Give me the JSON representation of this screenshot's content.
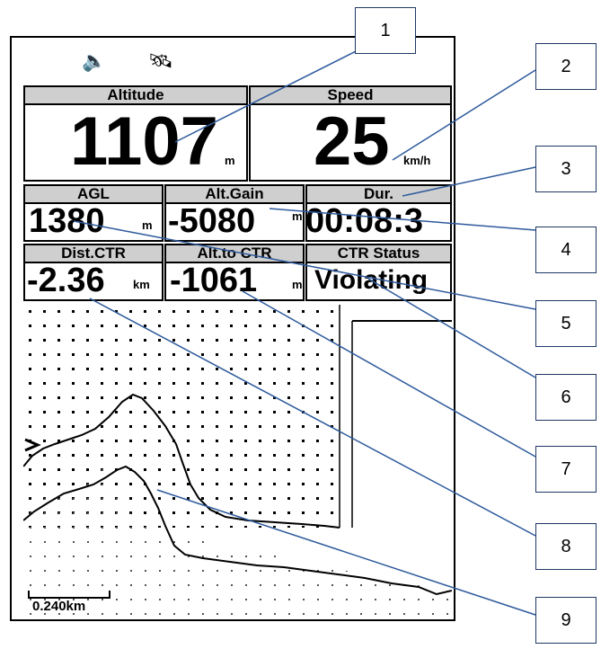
{
  "status_icons": {
    "speaker": "speaker-icon",
    "gps": "gps-satellite-icon"
  },
  "colors": {
    "label_bg": "#cfcfcf",
    "callout_border": "#1f3864",
    "leader_line": "#2e5a9c"
  },
  "panels": {
    "altitude": {
      "label": "Altitude",
      "value": "1107",
      "unit": "m"
    },
    "speed": {
      "label": "Speed",
      "value": "25",
      "unit": "km/h"
    },
    "agl": {
      "label": "AGL",
      "value": "1380",
      "unit": "m"
    },
    "alt_gain": {
      "label": "Alt.Gain",
      "value": "-5080",
      "unit": "m"
    },
    "duration": {
      "label": "Dur.",
      "value": "00:08:3"
    },
    "dist_ctr": {
      "label": "Dist.CTR",
      "value": "-2.36",
      "unit": "km"
    },
    "alt_to_ctr": {
      "label": "Alt.to CTR",
      "value": "-1061",
      "unit": "m"
    },
    "ctr_status": {
      "label": "CTR Status",
      "value": "Violating"
    }
  },
  "map": {
    "scale_label": "0.240km"
  },
  "callouts": [
    "1",
    "2",
    "3",
    "4",
    "5",
    "6",
    "7",
    "8",
    "9"
  ]
}
